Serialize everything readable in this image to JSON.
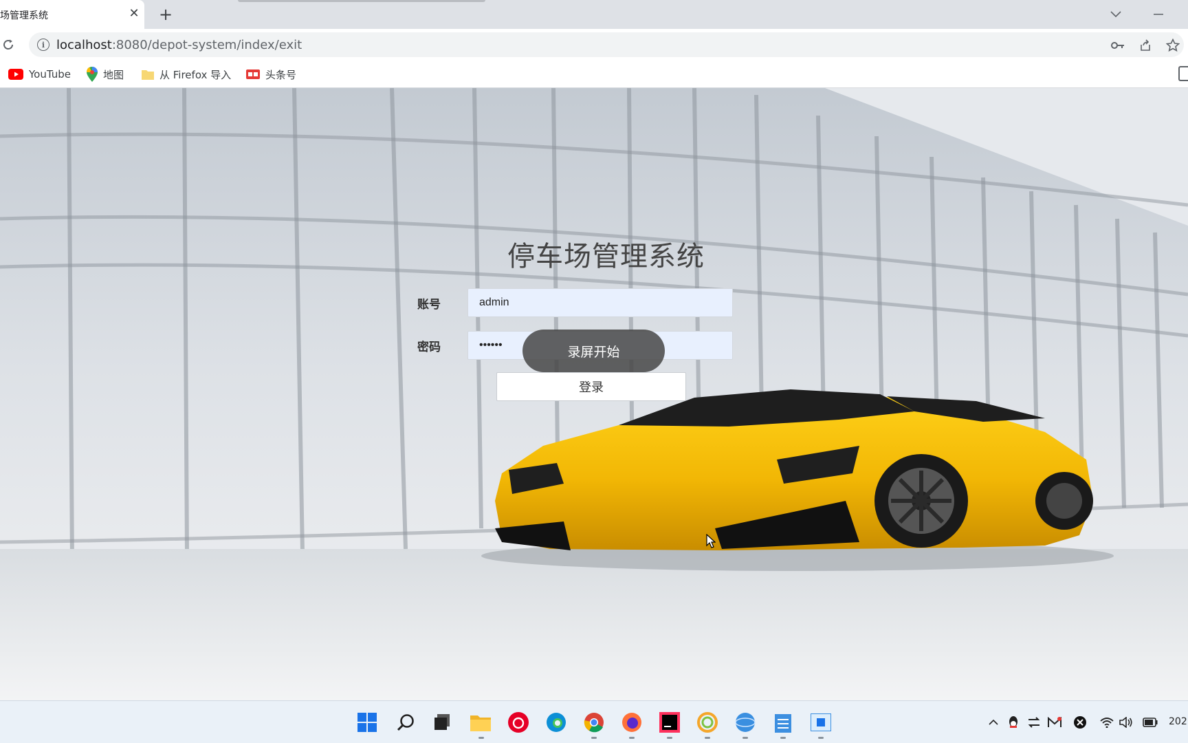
{
  "browser": {
    "tab_title": "场管理系统",
    "new_tab_symbol": "+",
    "close_symbol": "✕",
    "url_host": "localhost",
    "url_path": ":8080/depot-system/index/exit"
  },
  "bookmarks": [
    {
      "label": "YouTube",
      "icon": "youtube-icon"
    },
    {
      "label": "地图",
      "icon": "maps-pin-icon"
    },
    {
      "label": "从 Firefox 导入",
      "icon": "folder-icon"
    },
    {
      "label": "头条号",
      "icon": "toutiao-icon"
    }
  ],
  "login": {
    "title": "停车场管理系统",
    "account_label": "账号",
    "account_value": "admin",
    "password_label": "密码",
    "password_value": "••••••",
    "submit_label": "登录"
  },
  "overlay": {
    "record_toast": "录屏开始"
  },
  "taskbar": {
    "apps": [
      "start-icon",
      "search-icon",
      "task-view-icon",
      "file-explorer-icon",
      "netease-music-icon",
      "edge-icon",
      "chrome-icon",
      "firefox-icon",
      "intellij-icon",
      "app-circle-icon",
      "browser-globe-icon",
      "notepad-icon",
      "window-app-icon"
    ],
    "clock_text": "202"
  },
  "colors": {
    "omnibox_bg": "#f1f3f4",
    "input_autofill_bg": "#e8f0fe",
    "car_yellow": "#f2b705",
    "taskbar_bg": "#eaf1f8"
  }
}
